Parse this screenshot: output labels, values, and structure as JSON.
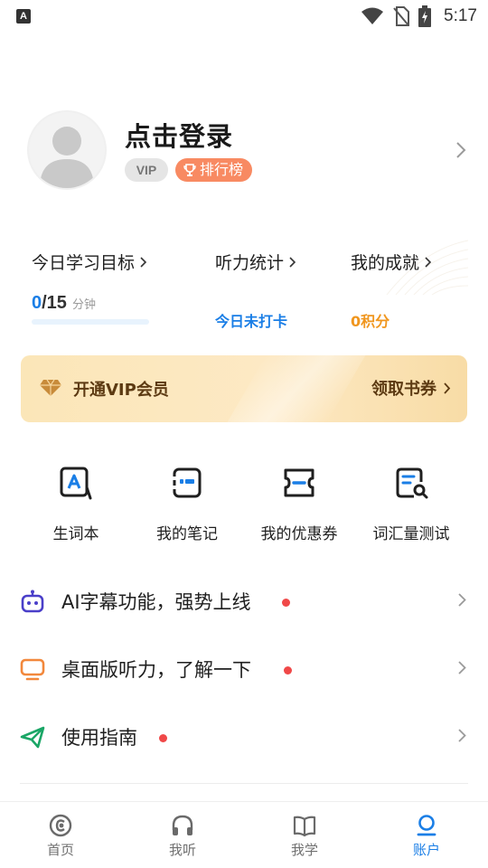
{
  "status_bar": {
    "app_letter": "A",
    "time": "5:17"
  },
  "profile": {
    "login_label": "点击登录",
    "vip_badge": "VIP",
    "rank_badge": "排行榜"
  },
  "stats": {
    "goal": {
      "title": "今日学习目标",
      "current": "0",
      "target": "/15",
      "unit": "分钟",
      "progress": 0
    },
    "listening": {
      "title": "听力统计",
      "status": "今日未打卡"
    },
    "achievement": {
      "title": "我的成就",
      "points": "0积分"
    }
  },
  "vip_banner": {
    "title": "开通VIP会员",
    "coupon_label": "领取书券"
  },
  "tools": [
    {
      "label": "生词本",
      "icon": "vocabulary-book-icon"
    },
    {
      "label": "我的笔记",
      "icon": "notes-icon"
    },
    {
      "label": "我的优惠券",
      "icon": "coupon-icon"
    },
    {
      "label": "词汇量测试",
      "icon": "vocab-test-icon"
    }
  ],
  "features": [
    {
      "label": "AI字幕功能，强势上线",
      "icon": "robot-icon",
      "has_dot": true
    },
    {
      "label": "桌面版听力，了解一下",
      "icon": "monitor-icon",
      "has_dot": true
    },
    {
      "label": "使用指南",
      "icon": "paper-plane-icon",
      "has_dot": true
    }
  ],
  "tab_bar": {
    "tabs": [
      {
        "label": "首页",
        "icon": "home-icon",
        "active": false
      },
      {
        "label": "我听",
        "icon": "headphones-icon",
        "active": false
      },
      {
        "label": "我学",
        "icon": "book-icon",
        "active": false
      },
      {
        "label": "账户",
        "icon": "account-icon",
        "active": true
      }
    ]
  },
  "colors": {
    "accent_blue": "#1a7ee6",
    "orange_badge": "#f88a62",
    "points_orange": "#f0961e",
    "notification_red": "#f04848",
    "vip_gold": "#fbe6b8"
  }
}
